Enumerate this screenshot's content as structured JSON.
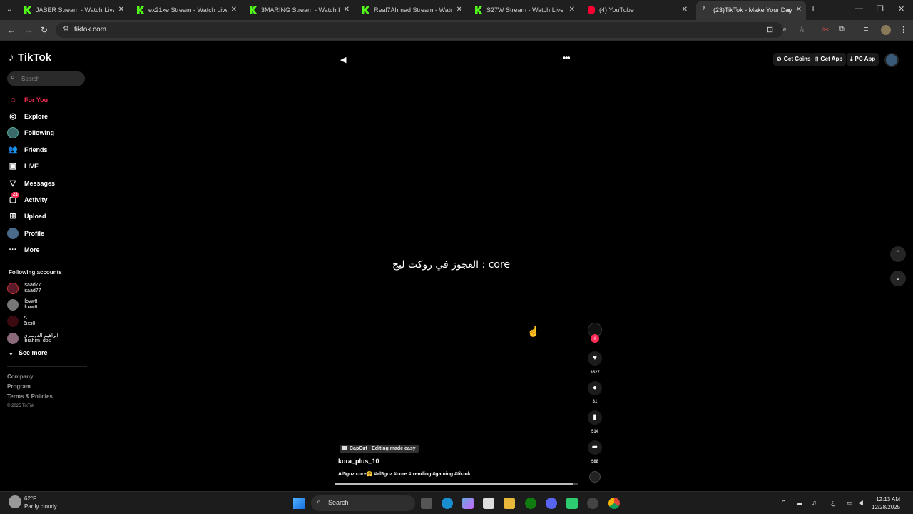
{
  "browser": {
    "tabs": [
      {
        "title": "JASER Stream - Watch Live on Kick",
        "favicon": "kick-icon"
      },
      {
        "title": "ex21xe Stream - Watch Live on Kick",
        "favicon": "kick-icon"
      },
      {
        "title": "3MARING Stream - Watch Live on Kick",
        "favicon": "kick-icon"
      },
      {
        "title": "Real7Ahmad Stream - Watch Live on Kick",
        "favicon": "kick-icon"
      },
      {
        "title": "S27W Stream - Watch Live on Kick",
        "favicon": "kick-icon"
      },
      {
        "title": "(4) YouTube",
        "favicon": "youtube-icon"
      },
      {
        "title": "(23)TikTok - Make Your Day",
        "favicon": "tiktok-icon"
      }
    ],
    "url": "tiktok.com"
  },
  "tiktok": {
    "logo": "TikTok",
    "search_placeholder": "Search",
    "nav": [
      {
        "label": "For You",
        "icon": "home-icon"
      },
      {
        "label": "Explore",
        "icon": "compass-icon"
      },
      {
        "label": "Following",
        "icon": "following-avatar-icon"
      },
      {
        "label": "Friends",
        "icon": "friends-icon"
      },
      {
        "label": "LIVE",
        "icon": "live-icon"
      },
      {
        "label": "Messages",
        "icon": "paper-plane-icon"
      },
      {
        "label": "Activity",
        "icon": "inbox-icon",
        "badge": "23"
      },
      {
        "label": "Upload",
        "icon": "plus-square-icon"
      },
      {
        "label": "Profile",
        "icon": "avatar-icon"
      },
      {
        "label": "More",
        "icon": "more-icon"
      }
    ],
    "following_title": "Following accounts",
    "accounts": [
      {
        "name": "lsaad77",
        "handle": "lsaad77_"
      },
      {
        "name": "llovw8",
        "handle": "llovw8"
      },
      {
        "name": "A",
        "handle": "6ixs0"
      },
      {
        "name": "ابراهيم الدوسري",
        "handle": "ibrahim_dos"
      }
    ],
    "see_more": "See more",
    "footer": [
      "Company",
      "Program",
      "Terms & Policies"
    ],
    "copyright": "© 2025 TikTok",
    "header": {
      "get_coins": "Get Coins",
      "get_app": "Get App",
      "pc_app": "PC App"
    },
    "video": {
      "overlay_text": "العجوز في روكت ليج : core",
      "capcut_label": "CapCut · Editing made easy",
      "author": "kora_plus_10",
      "description": "Al5goz core🤗 #al5goz #core #trending #gaming #tiktok",
      "progress": 0.98,
      "likes": "3527",
      "comments": "31",
      "saves": "514",
      "shares": "588"
    }
  },
  "taskbar": {
    "temperature": "62°F",
    "condition": "Partly cloudy",
    "search_label": "Search",
    "time": "12:13 AM",
    "date": "12/28/2025"
  },
  "colors": {
    "accent": "#fe2c55",
    "background": "#000000"
  }
}
